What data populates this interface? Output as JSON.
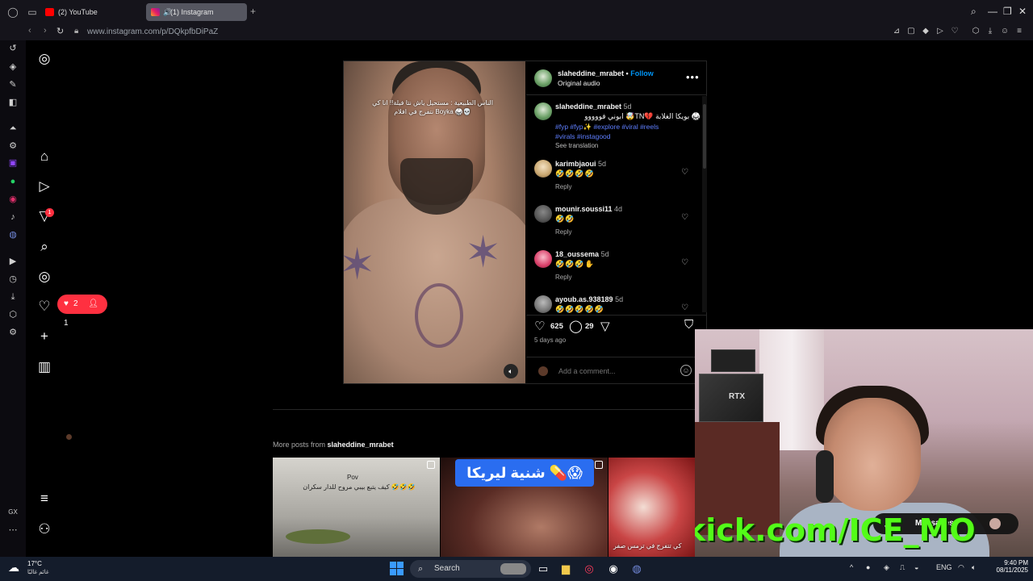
{
  "browser": {
    "tabs": [
      {
        "label": "(2) YouTube",
        "active": false
      },
      {
        "label": "(1) Instagram",
        "active": true
      }
    ],
    "url": "www.instagram.com/p/DQkpfbDiPaZ"
  },
  "ig_nav": {
    "notifications_badge": "1",
    "pill": {
      "likes": "2",
      "follows": "1"
    }
  },
  "post": {
    "author": "slaheddine_mrabet",
    "follow_label": "Follow",
    "separator": "•",
    "audio": "Original audio",
    "video_caption": "الناس الطبيعية : مستحيل ياش نتا فيلة!! انا كي نتفرج في افلام Boyka 🥋💀",
    "caption": {
      "user": "slaheddine_mrabet",
      "time": "5d",
      "text": "ابوني فووووو 🤯TN💔 بويكا الغلابة 🥋",
      "hashtags": "#fyp #fyp✨ #explore #viral #reels #virals #instagood",
      "see_translation": "See translation"
    },
    "comments": [
      {
        "user": "karimbjaoui",
        "time": "5d",
        "text": "🤣🤣🤣🤣",
        "reply": "Reply"
      },
      {
        "user": "mounir.soussi11",
        "time": "4d",
        "text": "🤣🤣",
        "reply": "Reply"
      },
      {
        "user": "18_oussema",
        "time": "5d",
        "text": "🤣🤣🤣✋",
        "reply": "Reply"
      },
      {
        "user": "ayoub.as.938189",
        "time": "5d",
        "text": "🤣🤣🤣🤣🤣",
        "reply": ""
      }
    ],
    "likes": "625",
    "comments_count": "29",
    "posted_ago": "5 days ago",
    "add_comment_placeholder": "Add a comment..."
  },
  "more_posts": {
    "prefix": "More posts from",
    "user": "slaheddine_mrabet",
    "thumbs": [
      {
        "caption_top": "Pov",
        "caption": "كيف يتبع بيبي مروح للدار سكران 🤣🤣🤣"
      },
      {
        "banner": "شنية ليريكا 💊😱"
      },
      {
        "caption": "كي تتفرج في ترمس صفر"
      }
    ]
  },
  "stream_overlay": {
    "gpu_label": "RTX",
    "kick_text": "kick.com/ICE_MO",
    "messages_label": "Messages"
  },
  "taskbar": {
    "temp": "17°C",
    "weather": "غائم غالبًا",
    "search": "Search",
    "lang": "ENG",
    "time": "9:40 PM",
    "date": "08/11/2025"
  },
  "icons": {
    "like": "heart-icon",
    "comment": "comment-icon",
    "share": "send-icon",
    "save": "bookmark-icon"
  }
}
